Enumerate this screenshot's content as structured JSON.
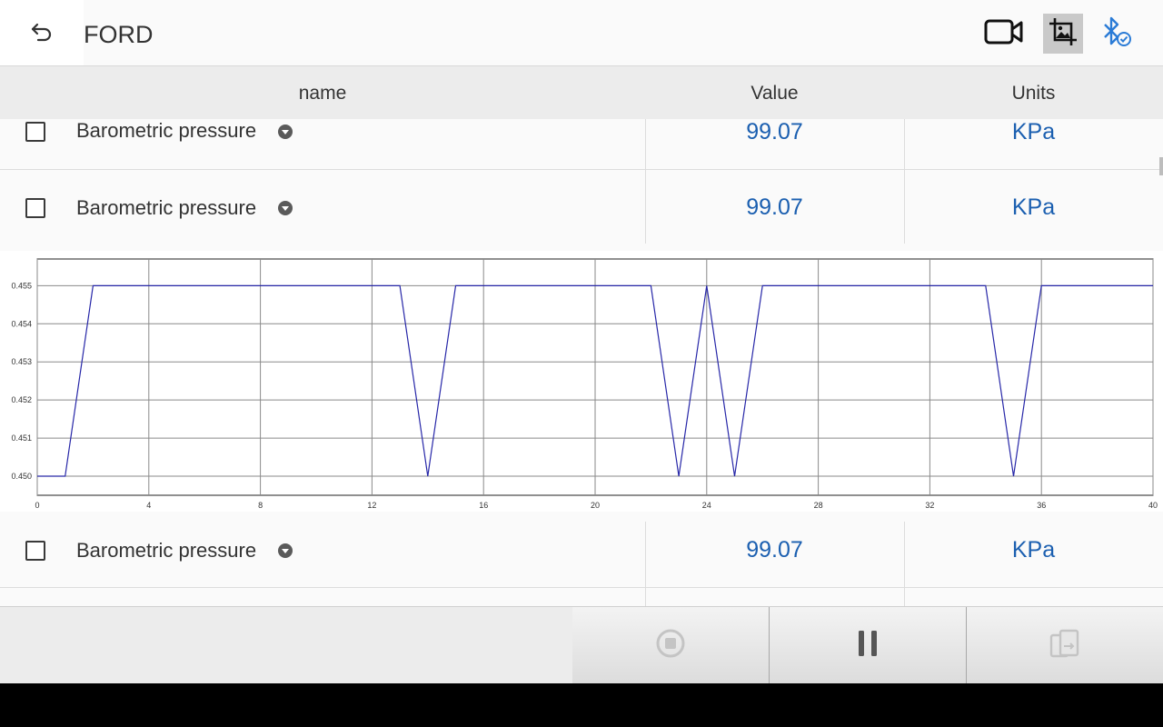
{
  "header": {
    "title": "FORD",
    "back_icon": "back-arrow-icon",
    "video_icon": "video-camera-icon",
    "image_icon": "image-crop-icon",
    "bluetooth_icon": "bluetooth-connected-icon"
  },
  "columns": {
    "name": "name",
    "value": "Value",
    "units": "Units"
  },
  "rows": [
    {
      "name": "Barometric pressure",
      "value": "99.07",
      "unit": "KPa"
    },
    {
      "name": "Barometric pressure",
      "value": "99.07",
      "unit": "KPa"
    },
    {
      "name": "Barometric pressure",
      "value": "99.07",
      "unit": "KPa"
    }
  ],
  "chart_data": {
    "type": "line",
    "xlim": [
      0,
      40
    ],
    "ylim": [
      0.4495,
      0.4557
    ],
    "x_ticks": [
      "0",
      "4",
      "8",
      "12",
      "16",
      "20",
      "24",
      "28",
      "32",
      "36",
      "40"
    ],
    "y_ticks": [
      "0.450",
      "0.451",
      "0.452",
      "0.453",
      "0.454",
      "0.455"
    ],
    "grid": true,
    "line_color": "#2727a8",
    "series": [
      {
        "x": [
          0,
          1,
          2,
          3,
          4,
          5,
          6,
          7,
          8,
          9,
          10,
          11,
          12,
          13,
          14,
          15,
          16,
          17,
          18,
          19,
          20,
          21,
          22,
          23,
          24,
          25,
          26,
          27,
          28,
          29,
          30,
          31,
          32,
          33,
          34,
          35,
          36,
          37,
          38,
          39,
          40
        ],
        "y": [
          0.45,
          0.45,
          0.455,
          0.455,
          0.455,
          0.455,
          0.455,
          0.455,
          0.455,
          0.455,
          0.455,
          0.455,
          0.455,
          0.455,
          0.45,
          0.455,
          0.455,
          0.455,
          0.455,
          0.455,
          0.455,
          0.455,
          0.455,
          0.45,
          0.455,
          0.45,
          0.455,
          0.455,
          0.455,
          0.455,
          0.455,
          0.455,
          0.455,
          0.455,
          0.455,
          0.45,
          0.455,
          0.455,
          0.455,
          0.455,
          0.455
        ]
      }
    ]
  },
  "bottom": {
    "stop_icon": "stop-record-icon",
    "pause_icon": "pause-icon",
    "export_icon": "export-file-icon"
  }
}
